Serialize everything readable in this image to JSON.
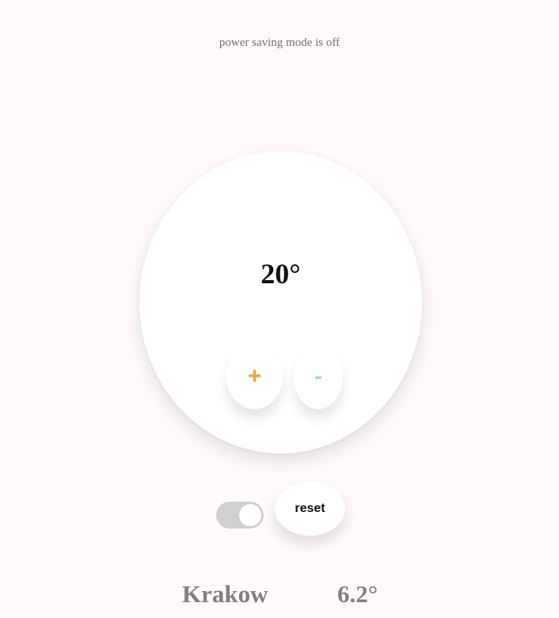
{
  "status": {
    "power_saving_text": "power saving mode is off"
  },
  "thermostat": {
    "temperature": "20°",
    "increase_label": "+",
    "decrease_label": "-",
    "reset_label": "reset",
    "power_saving_toggle_on": false
  },
  "weather": {
    "city": "Krakow",
    "temperature": "6.2°"
  },
  "colors": {
    "background": "#fffaf9",
    "increase_accent": "#f5a33a",
    "decrease_accent": "#a9d0ee",
    "toggle_track": "#d0d0d0",
    "muted_text": "#808080"
  },
  "icons": {
    "increase": "plus-icon",
    "decrease": "minus-icon"
  }
}
